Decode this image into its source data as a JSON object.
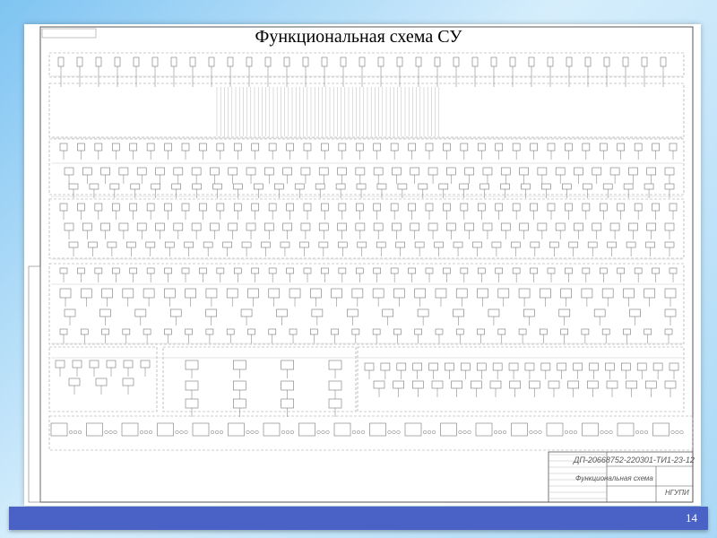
{
  "slide": {
    "title": "Функциональная схема СУ",
    "page_number": "14"
  },
  "drawing": {
    "stamp_top_left": "ДП-20668752-220301-ТИ1-23-12",
    "title_block": {
      "document_code": "ДП-20668752-220301-ТИ1-23-12",
      "document_name": "Функциональная схема",
      "organization": "НГУПИ"
    }
  }
}
